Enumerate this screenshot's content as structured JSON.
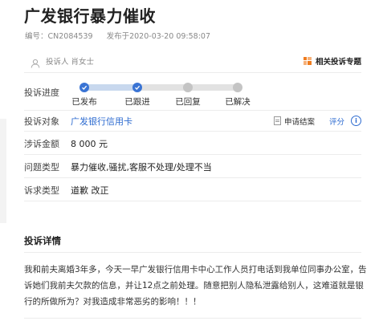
{
  "header": {
    "title": "广发银行暴力催收",
    "case_number": "编号：CN2084539",
    "published": "发布于2020-03-20 09:58:07"
  },
  "complainant": {
    "label": "投诉人",
    "name": "肖女士",
    "related_topics": "相关投诉专题"
  },
  "progress": {
    "label": "投诉进度",
    "steps": [
      {
        "label": "已发布",
        "done": true
      },
      {
        "label": "已跟进",
        "done": true
      },
      {
        "label": "已回复",
        "done": false
      },
      {
        "label": "已解决",
        "done": false
      }
    ]
  },
  "target": {
    "label": "投诉对象",
    "value": "广发银行信用卡",
    "apply_close": "申请结案",
    "rate": "评分",
    "info": "i"
  },
  "amount": {
    "label": "涉诉金额",
    "value": "8 000 元"
  },
  "issue_type": {
    "label": "问题类型",
    "value": "暴力催收,骚扰,客服不处理/处理不当"
  },
  "demand_type": {
    "label": "诉求类型",
    "value": "道歉 改正"
  },
  "detail": {
    "title": "投诉详情",
    "text": "我和前夫离婚3年多，今天一早广发银行信用卡中心工作人员打电话到我单位同事办公室，告诉她们我前夫欠款的信息，并让12点之前处理。随意把别人隐私泄露给别人，这难道就是银行的所做所为？对我造成非常恶劣的影响！！！"
  },
  "colors": {
    "accent": "#3a74d4",
    "link": "#2d6bd0",
    "brand_orange": "#f07c1e",
    "pending": "#c4c4c4"
  }
}
